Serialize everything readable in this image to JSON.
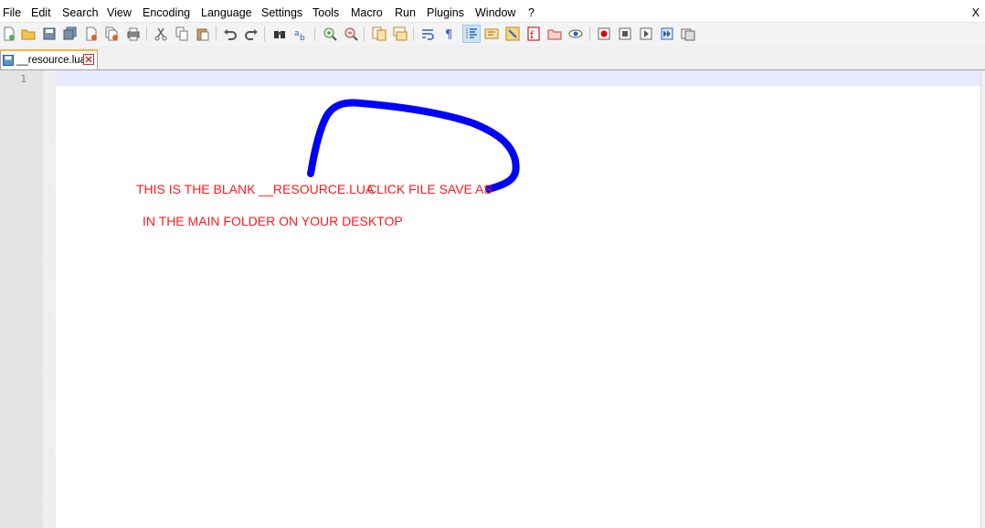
{
  "menu": [
    "File",
    "Edit",
    "Search",
    "View",
    "Encoding",
    "Language",
    "Settings",
    "Tools",
    "Macro",
    "Run",
    "Plugins",
    "Window",
    "?"
  ],
  "close_label": "X",
  "toolbar_icons": [
    "new-file",
    "open-file",
    "save",
    "save-all",
    "close",
    "close-all",
    "print",
    "cut",
    "copy",
    "paste",
    "undo",
    "redo",
    "find",
    "replace",
    "zoom-in",
    "zoom-out",
    "sync-vertical",
    "sync-horizontal",
    "word-wrap",
    "show-all-chars",
    "indent-guide",
    "user-defined-lang",
    "doc-map",
    "function-list",
    "folder-workspace",
    "monitoring",
    "record-macro",
    "stop-recording",
    "playback-macro",
    "run-macro-multiple",
    "save-macro"
  ],
  "tab": {
    "label": "__resource.lua",
    "close": "☒"
  },
  "editor": {
    "line_numbers": [
      "1"
    ]
  },
  "annotations": {
    "line1": "THIS IS THE BLANK __RESOURCE.LUA",
    "line1b": "CLICK FILE SAVE AS",
    "line2": "IN THE MAIN FOLDER ON YOUR DESKTOP",
    "text_color": "#ff1a1a",
    "scribble_color": "#0000ff"
  }
}
